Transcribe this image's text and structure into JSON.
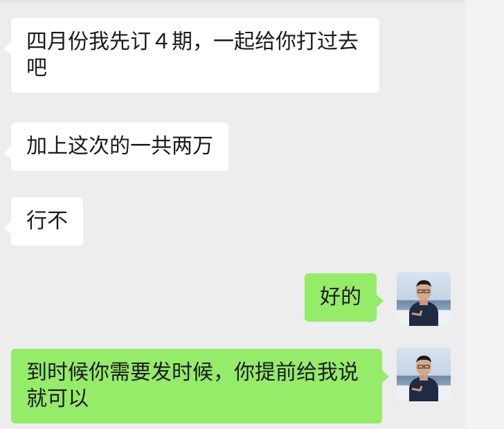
{
  "messages": [
    {
      "id": "m1",
      "side": "incoming",
      "text": "四月份我先订４期，一起给你打过去吧"
    },
    {
      "id": "m2",
      "side": "incoming",
      "text": "加上这次的一共两万"
    },
    {
      "id": "m3",
      "side": "incoming",
      "text": "行不"
    },
    {
      "id": "m4",
      "side": "outgoing",
      "text": "好的"
    },
    {
      "id": "m5",
      "side": "outgoing",
      "text": "到时候你需要发时候，你提前给我说就可以"
    }
  ],
  "colors": {
    "background": "#ededed",
    "incoming_bubble": "#ffffff",
    "outgoing_bubble": "#95ec69"
  },
  "icons": {
    "avatar": "user-avatar-icon"
  }
}
